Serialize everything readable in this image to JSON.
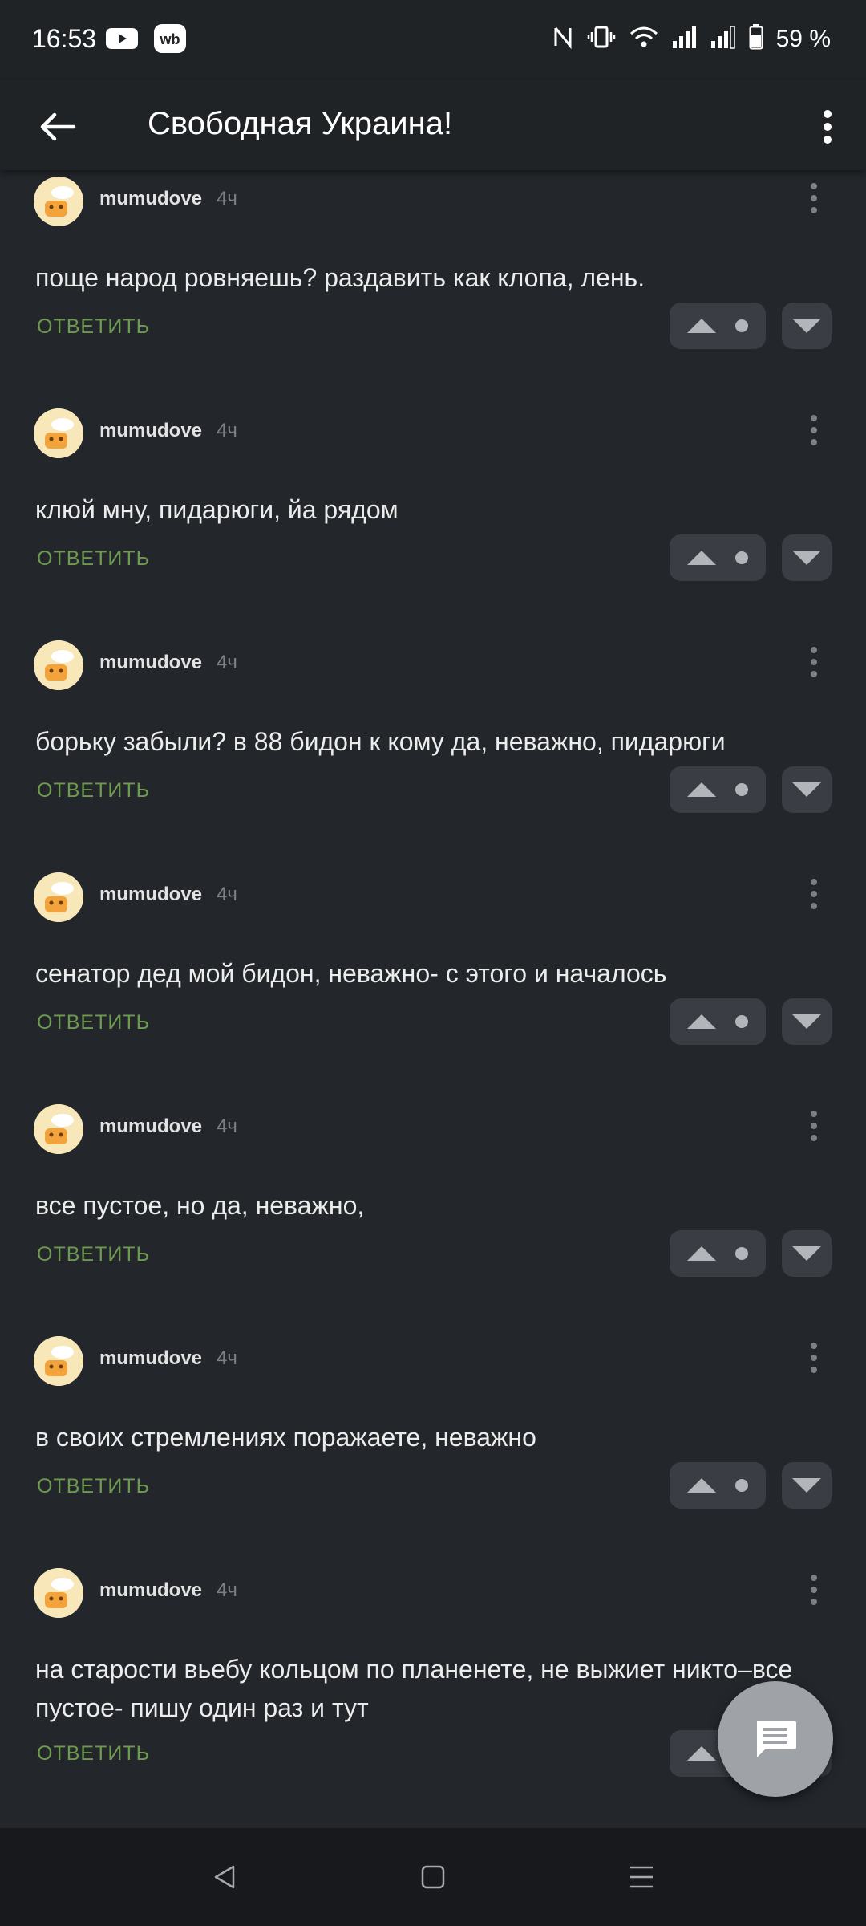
{
  "status_bar": {
    "time": "16:53",
    "app_icons": [
      "youtube-icon",
      "wildberries-icon"
    ],
    "app_wb_label": "wb",
    "system_icons": [
      "nfc-icon",
      "vibrate-icon",
      "wifi-icon",
      "signal-icon",
      "signal-icon",
      "battery-icon"
    ],
    "battery_percent": "59 %"
  },
  "toolbar": {
    "back_icon": "back-arrow-icon",
    "title": "Свободная Украина!",
    "menu_icon": "more-vert-icon"
  },
  "comments": [
    {
      "author": "mumudove",
      "time": "4ч",
      "text": "поще народ ровняешь? раздавить как клопа, лень.",
      "reply_label": "ОТВЕТИТЬ"
    },
    {
      "author": "mumudove",
      "time": "4ч",
      "text": "клюй мну, пидарюги, йа рядом",
      "reply_label": "ОТВЕТИТЬ"
    },
    {
      "author": "mumudove",
      "time": "4ч",
      "text": "борьку забыли? в 88 бидон к кому да, неважно, пидарюги",
      "reply_label": "ОТВЕТИТЬ"
    },
    {
      "author": "mumudove",
      "time": "4ч",
      "text": "сенатор дед мой бидон, неважно- с этого и началось",
      "reply_label": "ОТВЕТИТЬ"
    },
    {
      "author": "mumudove",
      "time": "4ч",
      "text": "все пустое, но да, неважно,",
      "reply_label": "ОТВЕТИТЬ"
    },
    {
      "author": "mumudove",
      "time": "4ч",
      "text": "в своих стремлениях поражаете, неважно",
      "reply_label": "ОТВЕТИТЬ"
    },
    {
      "author": "mumudove",
      "time": "4ч",
      "text": "на старости вьебу кольцом по планенете, не выжиет никто–все пустое- пишу один раз и тут",
      "reply_label": "ОТВЕТИТЬ"
    }
  ],
  "fab": {
    "icon": "comment-icon"
  },
  "nav_bar": {
    "icons": [
      "back-triangle-icon",
      "home-square-icon",
      "recents-menu-icon"
    ]
  },
  "colors": {
    "background": "#23262b",
    "toolbar": "#202326",
    "reply_green": "#6d9a4f",
    "vote_button": "#3a3e44",
    "time_gray": "#7c8086"
  }
}
